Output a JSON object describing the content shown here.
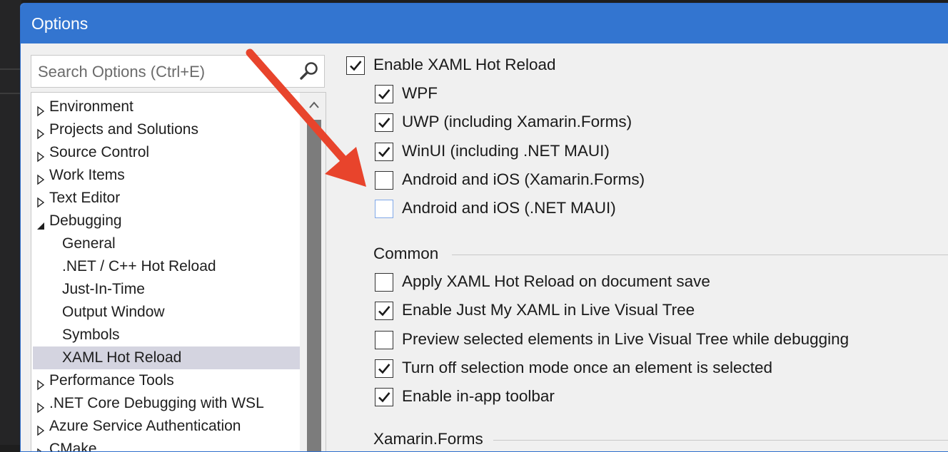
{
  "dialog": {
    "title": "Options"
  },
  "search": {
    "placeholder": "Search Options (Ctrl+E)",
    "icon": "search-icon"
  },
  "tree": {
    "items": [
      {
        "label": "Environment",
        "level": 0,
        "expanded": false
      },
      {
        "label": "Projects and Solutions",
        "level": 0,
        "expanded": false
      },
      {
        "label": "Source Control",
        "level": 0,
        "expanded": false
      },
      {
        "label": "Work Items",
        "level": 0,
        "expanded": false
      },
      {
        "label": "Text Editor",
        "level": 0,
        "expanded": false
      },
      {
        "label": "Debugging",
        "level": 0,
        "expanded": true
      },
      {
        "label": "General",
        "level": 1
      },
      {
        "label": ".NET / C++ Hot Reload",
        "level": 1
      },
      {
        "label": "Just-In-Time",
        "level": 1
      },
      {
        "label": "Output Window",
        "level": 1
      },
      {
        "label": "Symbols",
        "level": 1
      },
      {
        "label": "XAML Hot Reload",
        "level": 1,
        "selected": true
      },
      {
        "label": "Performance Tools",
        "level": 0,
        "expanded": false
      },
      {
        "label": ".NET Core Debugging with WSL",
        "level": 0,
        "expanded": false
      },
      {
        "label": "Azure Service Authentication",
        "level": 0,
        "expanded": false
      },
      {
        "label": "CMake",
        "level": 0,
        "expanded": false
      }
    ]
  },
  "options": {
    "enable_hot_reload": {
      "label": "Enable XAML Hot Reload",
      "checked": true
    },
    "platforms": [
      {
        "label": "WPF",
        "checked": true
      },
      {
        "label": "UWP (including Xamarin.Forms)",
        "checked": true
      },
      {
        "label": "WinUI (including .NET MAUI)",
        "checked": true
      },
      {
        "label": "Android and iOS (Xamarin.Forms)",
        "checked": false
      },
      {
        "label": "Android and iOS (.NET MAUI)",
        "checked": false,
        "focused": true
      }
    ],
    "common": {
      "title": "Common",
      "items": [
        {
          "label": "Apply XAML Hot Reload on document save",
          "checked": false
        },
        {
          "label": "Enable Just My XAML in Live Visual Tree",
          "checked": true
        },
        {
          "label": "Preview selected elements in Live Visual Tree while debugging",
          "checked": false
        },
        {
          "label": "Turn off selection mode once an element is selected",
          "checked": true
        },
        {
          "label": "Enable in-app toolbar",
          "checked": true
        }
      ]
    },
    "xamarin": {
      "title": "Xamarin.Forms"
    }
  },
  "colors": {
    "titlebar": "#3375d0",
    "annotation_arrow": "#e8442c",
    "selection": "#d4d4e0"
  }
}
